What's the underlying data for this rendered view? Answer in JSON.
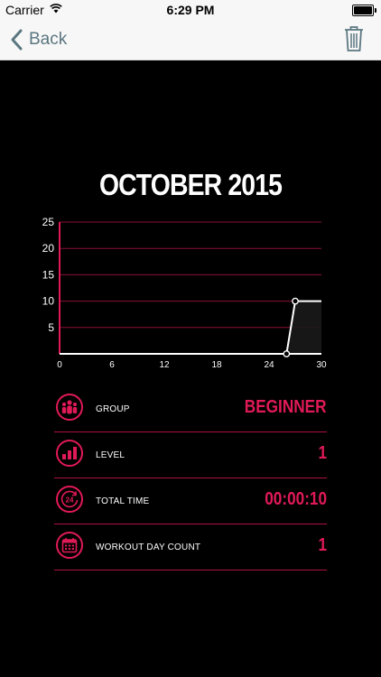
{
  "status_bar": {
    "carrier": "Carrier",
    "time": "6:29 PM"
  },
  "nav": {
    "back_label": "Back"
  },
  "month_title": "OCTOBER 2015",
  "chart_data": {
    "type": "line",
    "x": [
      0,
      26,
      27,
      30
    ],
    "y": [
      0,
      0,
      10,
      10
    ],
    "xticks": [
      "0",
      "6",
      "12",
      "18",
      "24",
      "30"
    ],
    "yticks": [
      "5",
      "10",
      "15",
      "20",
      "25"
    ],
    "xlim": [
      0,
      30
    ],
    "ylim": [
      0,
      25
    ],
    "grid": true,
    "colors": {
      "line": "#ffffff",
      "grid": "#8a1035",
      "axis": "#e01a57",
      "marker_fill": "#000000"
    }
  },
  "stats": [
    {
      "label": "GROUP",
      "value": "BEGINNER",
      "icon": "group-icon"
    },
    {
      "label": "LEVEL",
      "value": "1",
      "icon": "level-icon"
    },
    {
      "label": "TOTAL TIME",
      "value": "00:00:10",
      "icon": "clock-24-icon"
    },
    {
      "label": "WORKOUT DAY COUNT",
      "value": "1",
      "icon": "calendar-icon"
    }
  ],
  "colors": {
    "accent": "#e01a57",
    "nav_tint": "#5b7780",
    "background": "#000000"
  }
}
